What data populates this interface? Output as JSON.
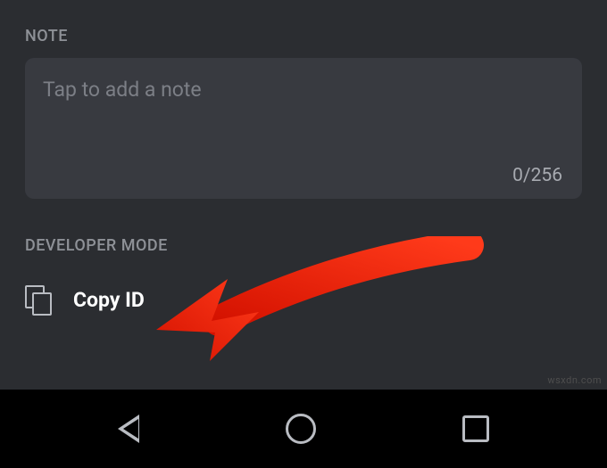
{
  "note": {
    "header": "NOTE",
    "placeholder": "Tap to add a note",
    "counter": "0/256"
  },
  "developer": {
    "header": "DEVELOPER MODE",
    "copy_id_label": "Copy ID"
  },
  "watermark": "wsxdn.com"
}
